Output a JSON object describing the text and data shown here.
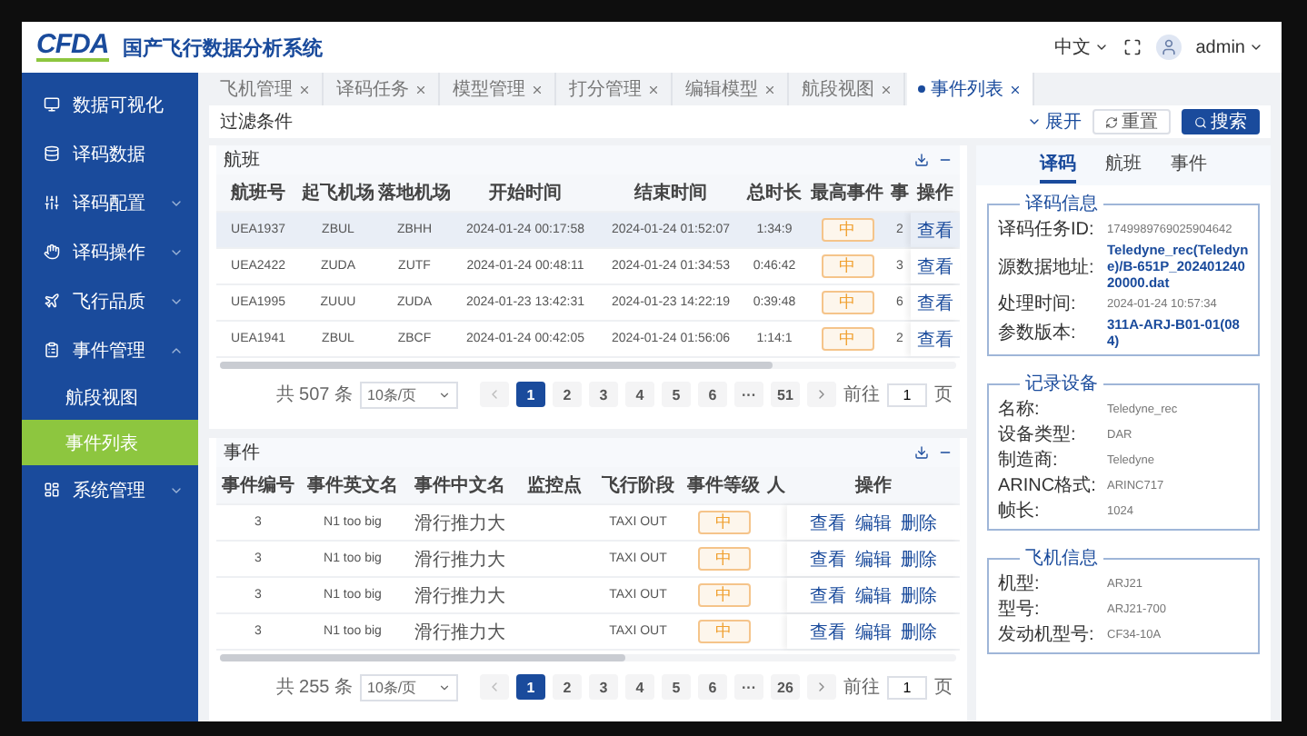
{
  "header": {
    "logo": "CFDA",
    "title": "国产飞行数据分析系统",
    "language": "中文",
    "user": "admin"
  },
  "sidebar": {
    "items": [
      {
        "label": "数据可视化",
        "kind": "link"
      },
      {
        "label": "译码数据",
        "kind": "link"
      },
      {
        "label": "译码配置",
        "kind": "group",
        "expanded": false
      },
      {
        "label": "译码操作",
        "kind": "group",
        "expanded": false
      },
      {
        "label": "飞行品质",
        "kind": "group",
        "expanded": false
      },
      {
        "label": "事件管理",
        "kind": "group",
        "expanded": true,
        "children": [
          {
            "label": "航段视图",
            "selected": false
          },
          {
            "label": "事件列表",
            "selected": true
          }
        ]
      },
      {
        "label": "系统管理",
        "kind": "group",
        "expanded": false
      }
    ]
  },
  "tabs": [
    {
      "label": "飞机管理",
      "selected": false
    },
    {
      "label": "译码任务",
      "selected": false
    },
    {
      "label": "模型管理",
      "selected": false
    },
    {
      "label": "打分管理",
      "selected": false
    },
    {
      "label": "编辑模型",
      "selected": false
    },
    {
      "label": "航段视图",
      "selected": false
    },
    {
      "label": "事件列表",
      "selected": true
    }
  ],
  "filter": {
    "title": "过滤条件",
    "expand": "展开",
    "reset": "重置",
    "search": "搜索"
  },
  "flights": {
    "title": "航班",
    "columns": [
      "航班号",
      "起飞机场",
      "落地机场",
      "开始时间",
      "结束时间",
      "总时长",
      "最高事件",
      "事"
    ],
    "action_column": "操作",
    "rows": [
      {
        "cells": [
          "UEA1937",
          "ZBUL",
          "ZBHH",
          "2024-01-24 00:17:58",
          "2024-01-24 01:52:07",
          "1:34:9",
          "中",
          "2"
        ],
        "action": "查看",
        "selected": true
      },
      {
        "cells": [
          "UEA2422",
          "ZUDA",
          "ZUTF",
          "2024-01-24 00:48:11",
          "2024-01-24 01:34:53",
          "0:46:42",
          "中",
          "3"
        ],
        "action": "查看",
        "selected": false
      },
      {
        "cells": [
          "UEA1995",
          "ZUUU",
          "ZUDA",
          "2024-01-23 13:42:31",
          "2024-01-23 14:22:19",
          "0:39:48",
          "中",
          "6"
        ],
        "action": "查看",
        "selected": false
      },
      {
        "cells": [
          "UEA1941",
          "ZBUL",
          "ZBCF",
          "2024-01-24 00:42:05",
          "2024-01-24 01:56:06",
          "1:14:1",
          "中",
          "2"
        ],
        "action": "查看",
        "selected": false
      }
    ],
    "pagination": {
      "total": "共 507 条",
      "page_size": "10条/页",
      "pages": [
        {
          "label": "1",
          "selected": true
        },
        {
          "label": "2",
          "selected": false
        },
        {
          "label": "3",
          "selected": false
        },
        {
          "label": "4",
          "selected": false
        },
        {
          "label": "5",
          "selected": false
        },
        {
          "label": "6",
          "selected": false
        },
        {
          "label": "···",
          "selected": false
        },
        {
          "label": "51",
          "selected": false
        }
      ],
      "goto": "前往",
      "goto_value": "1",
      "page_unit": "页"
    }
  },
  "events": {
    "title": "事件",
    "columns": [
      "事件编号",
      "事件英文名",
      "事件中文名",
      "监控点",
      "飞行阶段",
      "事件等级",
      "人"
    ],
    "action_column": "操作",
    "rows": [
      {
        "cells": [
          "3",
          "N1 too big",
          "滑行推力大",
          "",
          "TAXI OUT",
          "中",
          ""
        ],
        "actions": [
          "查看",
          "编辑",
          "删除"
        ],
        "selected": false
      },
      {
        "cells": [
          "3",
          "N1 too big",
          "滑行推力大",
          "",
          "TAXI OUT",
          "中",
          ""
        ],
        "actions": [
          "查看",
          "编辑",
          "删除"
        ],
        "selected": false
      },
      {
        "cells": [
          "3",
          "N1 too big",
          "滑行推力大",
          "",
          "TAXI OUT",
          "中",
          ""
        ],
        "actions": [
          "查看",
          "编辑",
          "删除"
        ],
        "selected": false
      },
      {
        "cells": [
          "3",
          "N1 too big",
          "滑行推力大",
          "",
          "TAXI OUT",
          "中",
          ""
        ],
        "actions": [
          "查看",
          "编辑",
          "删除"
        ],
        "selected": false
      }
    ],
    "pagination": {
      "total": "共 255 条",
      "page_size": "10条/页",
      "pages": [
        {
          "label": "1",
          "selected": true
        },
        {
          "label": "2",
          "selected": false
        },
        {
          "label": "3",
          "selected": false
        },
        {
          "label": "4",
          "selected": false
        },
        {
          "label": "5",
          "selected": false
        },
        {
          "label": "6",
          "selected": false
        },
        {
          "label": "···",
          "selected": false
        },
        {
          "label": "26",
          "selected": false
        }
      ],
      "goto": "前往",
      "goto_value": "1",
      "page_unit": "页"
    }
  },
  "detail": {
    "tabs": [
      {
        "label": "译码",
        "selected": true
      },
      {
        "label": "航班",
        "selected": false
      },
      {
        "label": "事件",
        "selected": false
      }
    ],
    "groups": [
      {
        "title": "译码信息",
        "fields": [
          {
            "label": "译码任务ID:",
            "value": "1749989769025904642",
            "kind": "text"
          },
          {
            "label": "源数据地址:",
            "value": "Teledyne_rec(Teledyne)/B-651P_20240124020000.dat",
            "kind": "link"
          },
          {
            "label": "处理时间:",
            "value": "2024-01-24 10:57:34",
            "kind": "text"
          },
          {
            "label": "参数版本:",
            "value": "311A-ARJ-B01-01(084)",
            "kind": "link"
          }
        ]
      },
      {
        "title": "记录设备",
        "fields": [
          {
            "label": "名称:",
            "value": "Teledyne_rec",
            "kind": "text"
          },
          {
            "label": "设备类型:",
            "value": "DAR",
            "kind": "text"
          },
          {
            "label": "制造商:",
            "value": "Teledyne",
            "kind": "text"
          },
          {
            "label": "ARINC格式:",
            "value": "ARINC717",
            "kind": "text"
          },
          {
            "label": "帧长:",
            "value": "1024",
            "kind": "text"
          }
        ]
      },
      {
        "title": "飞机信息",
        "fields": [
          {
            "label": "机型:",
            "value": "ARJ21",
            "kind": "text"
          },
          {
            "label": "型号:",
            "value": "ARJ21-700",
            "kind": "text"
          },
          {
            "label": "发动机型号:",
            "value": "CF34-10A",
            "kind": "text"
          }
        ]
      }
    ]
  }
}
